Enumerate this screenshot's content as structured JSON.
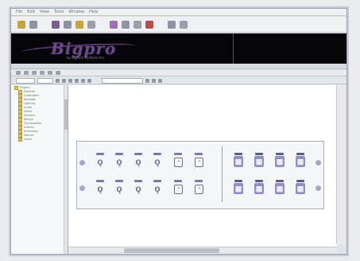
{
  "window": {
    "menu": [
      "File",
      "Edit",
      "View",
      "Tools",
      "Window",
      "Help"
    ]
  },
  "banner": {
    "logo": "Bigpro",
    "tagline": "by Bigtech Systems Inc."
  },
  "colors": {
    "banner_bg": "#05050a",
    "logo": "#6b4a86",
    "accent_line": "#c81e2c",
    "panel_icons": "#6e6b9a",
    "tree_text": "#4b7d3f"
  },
  "sidebar": {
    "items": [
      {
        "label": "Project"
      },
      {
        "label": "Devices"
      },
      {
        "label": "Controllers"
      },
      {
        "label": "Keypads"
      },
      {
        "label": "Lighting"
      },
      {
        "label": "Audio"
      },
      {
        "label": "Video"
      },
      {
        "label": "Sensors"
      },
      {
        "label": "Relays"
      },
      {
        "label": "Thermostats"
      },
      {
        "label": "Scenes"
      },
      {
        "label": "Schedules"
      },
      {
        "label": "Macros"
      },
      {
        "label": "Users"
      }
    ]
  },
  "panel": {
    "left_group_icons": [
      "q-icon",
      "q-icon",
      "q-icon",
      "q-icon",
      "power-icon",
      "power-icon"
    ],
    "right_group_icons": [
      "disk-icon",
      "disk-icon",
      "disk-icon",
      "disk-icon"
    ]
  }
}
